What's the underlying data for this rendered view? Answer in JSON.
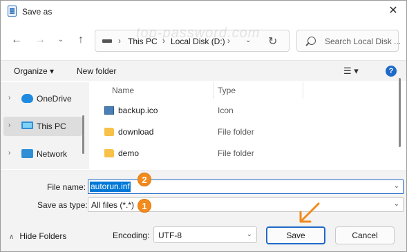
{
  "window": {
    "title": "Save as"
  },
  "address": {
    "segments": [
      "This PC",
      "Local Disk (D:)"
    ]
  },
  "search": {
    "placeholder": "Search Local Disk ..."
  },
  "watermark": "top-password.com",
  "toolbar": {
    "organize": "Organize ▾",
    "new_folder": "New folder"
  },
  "nav": {
    "items": [
      {
        "label": "OneDrive",
        "icon": "onedrive-cloud-icon",
        "selected": false
      },
      {
        "label": "This PC",
        "icon": "monitor-icon",
        "selected": true
      },
      {
        "label": "Network",
        "icon": "network-icon",
        "selected": false
      }
    ]
  },
  "files": {
    "columns": [
      "Name",
      "Type"
    ],
    "rows": [
      {
        "name": "backup.ico",
        "type": "Icon",
        "icon": "image-file-icon"
      },
      {
        "name": "download",
        "type": "File folder",
        "icon": "folder-icon"
      },
      {
        "name": "demo",
        "type": "File folder",
        "icon": "folder-icon"
      }
    ]
  },
  "form": {
    "file_name_label": "File name:",
    "file_name_value": "autorun.inf",
    "save_type_label": "Save as type:",
    "save_type_value": "All files  (*.*)"
  },
  "footer": {
    "hide_folders": "Hide Folders",
    "encoding_label": "Encoding:",
    "encoding_value": "UTF-8",
    "save_button": "Save",
    "cancel_button": "Cancel"
  },
  "annotations": {
    "badge_file_name": "2",
    "badge_save_type": "1"
  },
  "colors": {
    "accent": "#1f69c7",
    "selection": "#0078d7",
    "annotation": "#f28a1c"
  }
}
